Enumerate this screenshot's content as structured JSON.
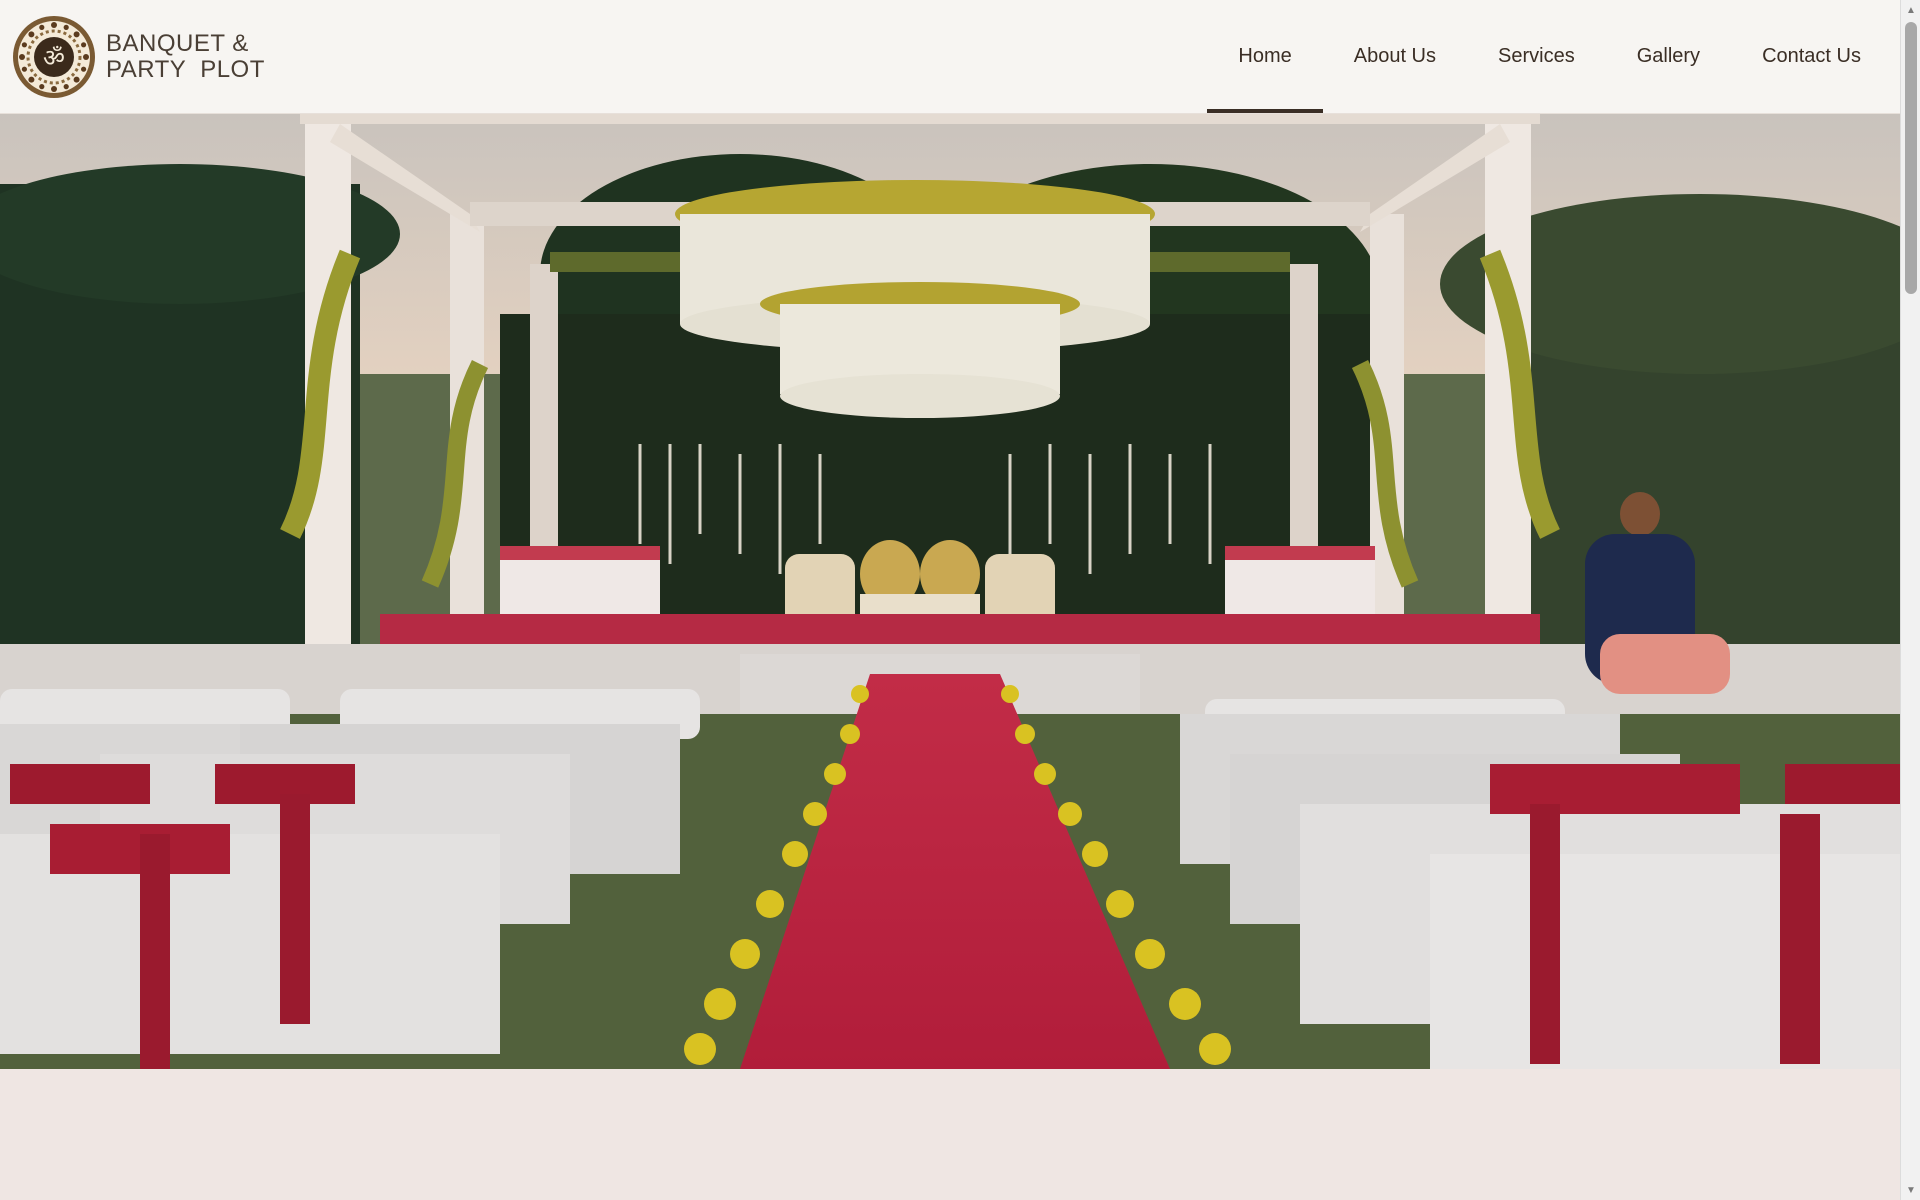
{
  "brand": {
    "name_line1": "BANQUET &",
    "name_line2": "PARTY  PLOT",
    "logo_icon": "om-mandala-logo-icon"
  },
  "nav": {
    "items": [
      {
        "label": "Home",
        "active": true
      },
      {
        "label": "About Us",
        "active": false
      },
      {
        "label": "Services",
        "active": false
      },
      {
        "label": "Gallery",
        "active": false
      },
      {
        "label": "Contact Us",
        "active": false
      }
    ]
  },
  "hero": {
    "image_subject": "outdoor wedding mandap with red carpet aisle, white chairs and floral chandelier",
    "scroll_button_icon": "arrow-down-icon"
  },
  "colors": {
    "header_bg": "#f7f5f2",
    "nav_text": "#3a2e25",
    "page_bg": "#efe6e3",
    "carpet_red": "#b8233f"
  }
}
